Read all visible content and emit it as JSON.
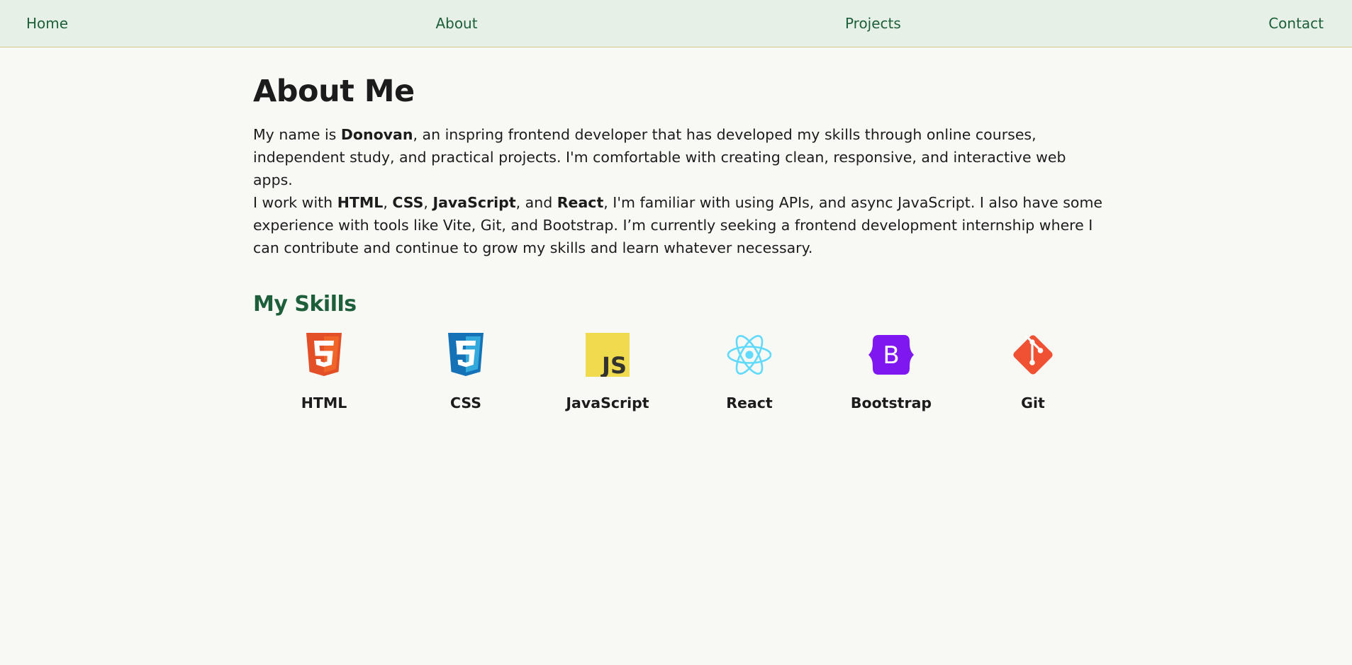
{
  "nav": {
    "items": [
      {
        "label": "Home"
      },
      {
        "label": "About"
      },
      {
        "label": "Projects"
      },
      {
        "label": "Contact"
      }
    ]
  },
  "about": {
    "title": "About Me",
    "p1": {
      "t1": "My name is ",
      "name": "Donovan",
      "t2": ", an inspring frontend developer that has developed my skills through online courses, independent study, and practical projects. I'm comfortable with creating clean, responsive, and interactive web apps."
    },
    "p2": {
      "t1": "I work with ",
      "html": "HTML",
      "sep1": ", ",
      "css": "CSS",
      "sep2": ", ",
      "js": "JavaScript",
      "sep3": ", and ",
      "react": "React",
      "t2": ", I'm familiar with using APIs, and async JavaScript. I also have some experience with tools like Vite, Git, and Bootstrap. I’m currently seeking a frontend development internship where I can contribute and continue to grow my skills and learn whatever necessary."
    }
  },
  "skills": {
    "title": "My Skills",
    "items": [
      {
        "label": "HTML",
        "icon": "html5-icon",
        "color": "#e34f26"
      },
      {
        "label": "CSS",
        "icon": "css3-icon",
        "color": "#1572b6"
      },
      {
        "label": "JavaScript",
        "icon": "javascript-icon",
        "color": "#f0db4f",
        "glyph": "JS"
      },
      {
        "label": "React",
        "icon": "react-icon",
        "color": "#61dafb"
      },
      {
        "label": "Bootstrap",
        "icon": "bootstrap-icon",
        "color": "#7952b3",
        "glyph": "B"
      },
      {
        "label": "Git",
        "icon": "git-icon",
        "color": "#f05133"
      }
    ]
  },
  "colors": {
    "nav_background": "#e6f0e6",
    "accent_green": "#1d5f3a",
    "page_background": "#f8f8f4",
    "nav_border": "#d4c98a"
  }
}
